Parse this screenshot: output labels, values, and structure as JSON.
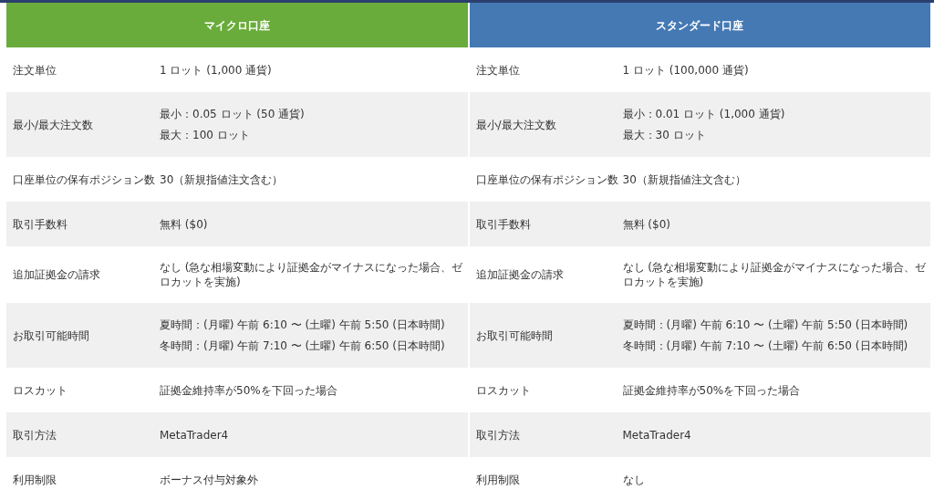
{
  "accounts": [
    {
      "title": "マイクロ口座",
      "color": "#6aac3b",
      "rows": [
        {
          "label": "注文単位",
          "lines": [
            "1 ロット (1,000 通貨)"
          ]
        },
        {
          "label": "最小/最大注文数",
          "lines": [
            "最小：0.05 ロット (50 通貨)",
            "最大：100 ロット"
          ]
        },
        {
          "label": "口座単位の保有ポジション数",
          "lines": [
            "30（新規指値注文含む）"
          ]
        },
        {
          "label": "取引手数料",
          "lines": [
            "無料 ($0)"
          ]
        },
        {
          "label": "追加証拠金の請求",
          "lines": [
            "なし (急な相場変動により証拠金がマイナスになった場合、ゼロカットを実施)"
          ]
        },
        {
          "label": "お取引可能時間",
          "lines": [
            "夏時間：(月曜) 午前 6:10 〜 (土曜) 午前 5:50 (日本時間)",
            "冬時間：(月曜) 午前 7:10 〜 (土曜) 午前 6:50 (日本時間)"
          ]
        },
        {
          "label": "ロスカット",
          "lines": [
            "証拠金維持率が50%を下回った場合"
          ]
        },
        {
          "label": "取引方法",
          "lines": [
            "MetaTrader4"
          ]
        },
        {
          "label": "利用制限",
          "lines": [
            "ボーナス付与対象外"
          ]
        }
      ]
    },
    {
      "title": "スタンダード口座",
      "color": "#4479b4",
      "rows": [
        {
          "label": "注文単位",
          "lines": [
            "1 ロット (100,000 通貨)"
          ]
        },
        {
          "label": "最小/最大注文数",
          "lines": [
            "最小：0.01 ロット (1,000 通貨)",
            "最大：30 ロット"
          ]
        },
        {
          "label": "口座単位の保有ポジション数",
          "lines": [
            "30（新規指値注文含む）"
          ]
        },
        {
          "label": "取引手数料",
          "lines": [
            "無料 ($0)"
          ]
        },
        {
          "label": "追加証拠金の請求",
          "lines": [
            "なし (急な相場変動により証拠金がマイナスになった場合、ゼロカットを実施)"
          ]
        },
        {
          "label": "お取引可能時間",
          "lines": [
            "夏時間：(月曜) 午前 6:10 〜 (土曜) 午前 5:50 (日本時間)",
            "冬時間：(月曜) 午前 7:10 〜 (土曜) 午前 6:50 (日本時間)"
          ]
        },
        {
          "label": "ロスカット",
          "lines": [
            "証拠金維持率が50%を下回った場合"
          ]
        },
        {
          "label": "取引方法",
          "lines": [
            "MetaTrader4"
          ]
        },
        {
          "label": "利用制限",
          "lines": [
            "なし"
          ]
        }
      ]
    }
  ]
}
